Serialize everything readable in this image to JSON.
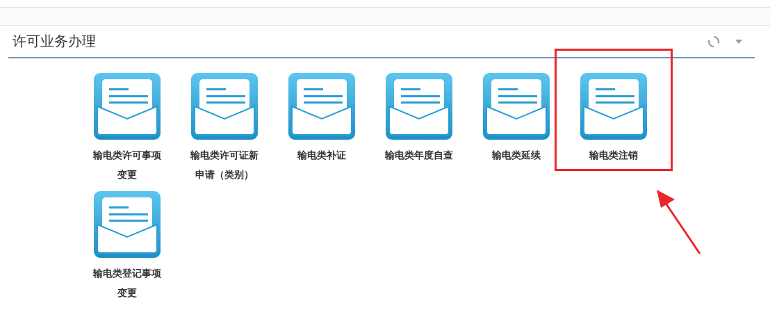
{
  "panel": {
    "title": "许可业务办理"
  },
  "items": [
    {
      "label": "输电类许可事项变更",
      "highlighted": false
    },
    {
      "label": "输电类许可证新申请（类别）",
      "highlighted": false
    },
    {
      "label": "输电类补证",
      "highlighted": false
    },
    {
      "label": "输电类年度自查",
      "highlighted": false
    },
    {
      "label": "输电类延续",
      "highlighted": false
    },
    {
      "label": "输电类注销",
      "highlighted": true
    },
    {
      "label": "输电类登记事项变更",
      "highlighted": false
    }
  ]
}
